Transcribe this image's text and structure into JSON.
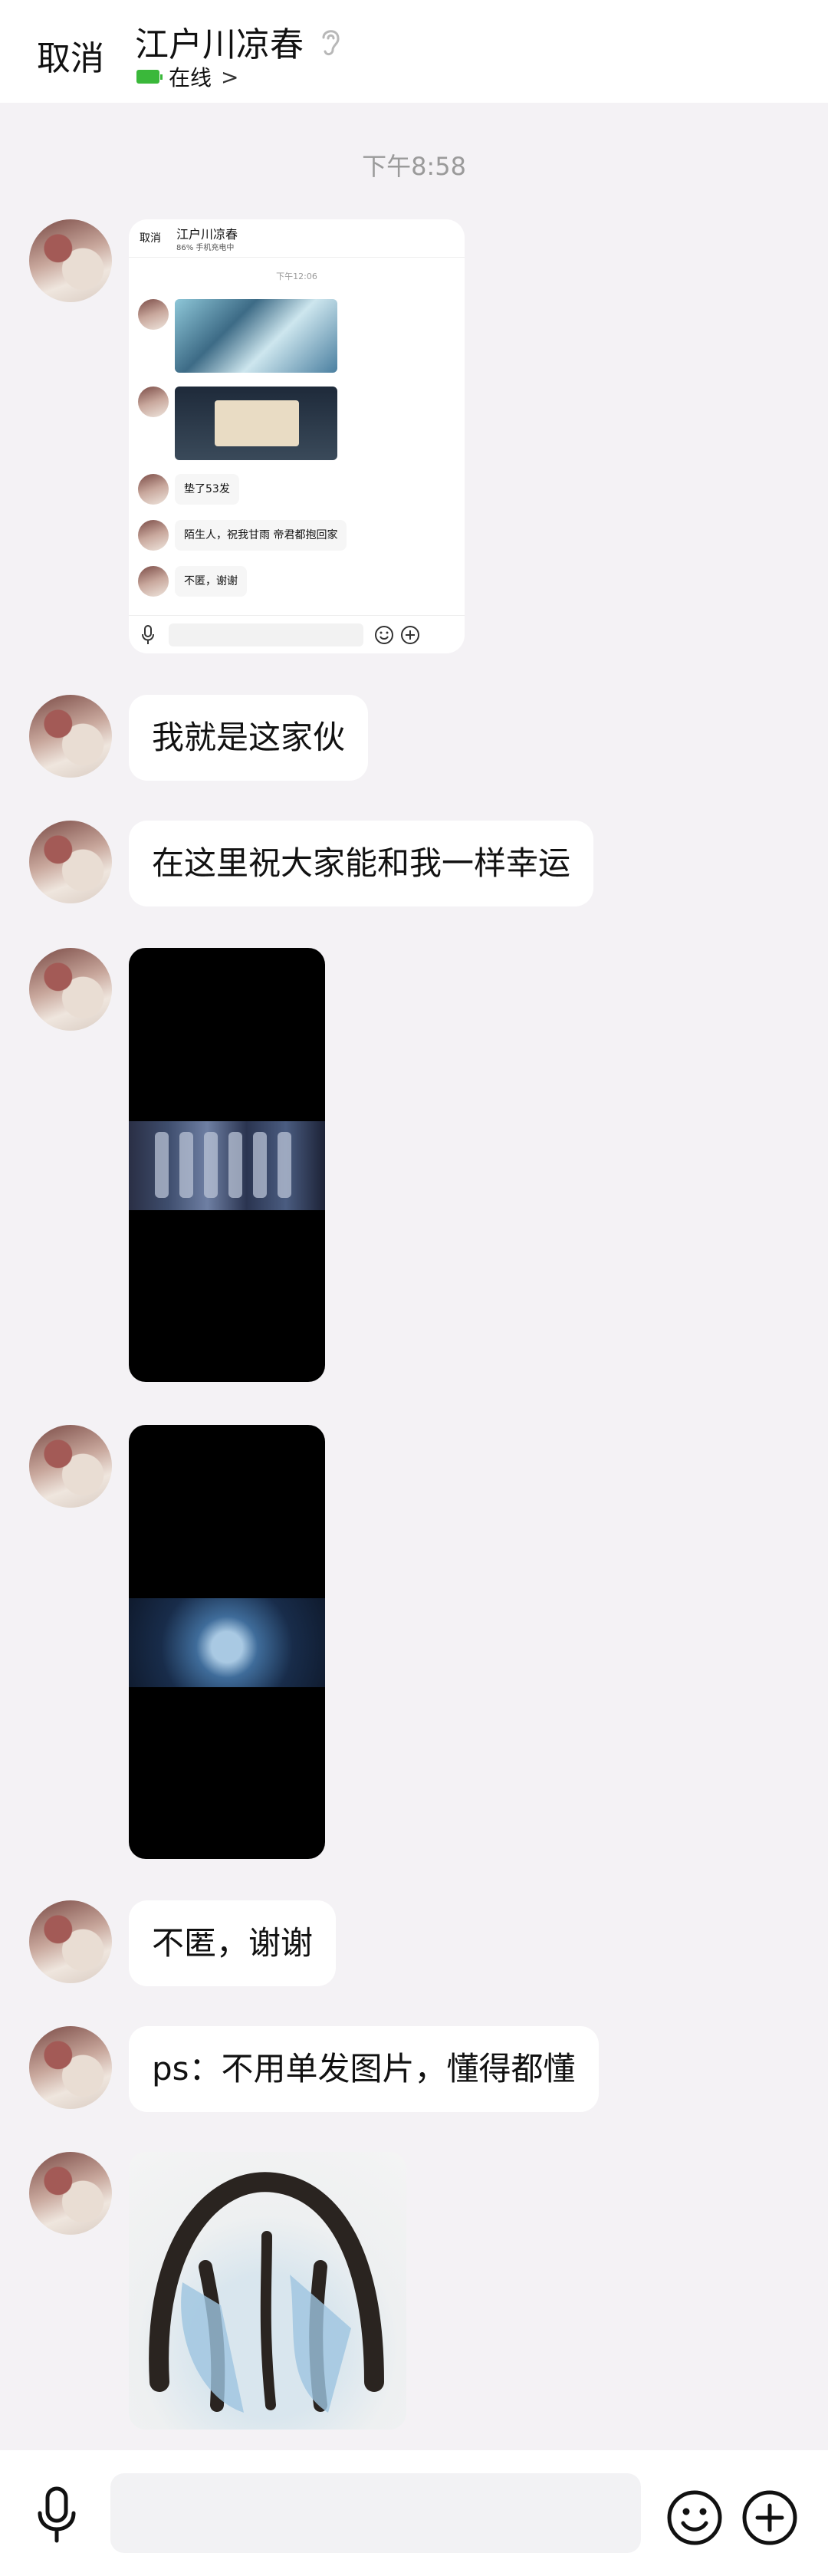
{
  "header": {
    "cancel_label": "取消",
    "contact_name": "江户川凉春",
    "status_text": "在线",
    "status_chevron": ">"
  },
  "timestamp": "下午8:58",
  "messages": [
    {
      "type": "screenshot",
      "inner": {
        "cancel_label": "取消",
        "title": "江户川凉春",
        "status": "86% 手机充电中",
        "time": "下午12:06",
        "texts": [
          "垫了53发",
          "陌生人，祝我甘雨 帝君都抱回家",
          "不匿，谢谢"
        ]
      }
    },
    {
      "type": "text",
      "text": "我就是这家伙"
    },
    {
      "type": "text",
      "text": "在这里祝大家能和我一样幸运"
    },
    {
      "type": "image",
      "description": "gacha-result-image-1"
    },
    {
      "type": "image",
      "description": "gacha-result-image-2"
    },
    {
      "type": "text",
      "text": "不匿，谢谢"
    },
    {
      "type": "text",
      "text": "ps：不用单发图片，懂得都懂"
    },
    {
      "type": "sticker"
    }
  ],
  "input_bar": {
    "icons": [
      "microphone-icon",
      "emoji-icon",
      "plus-icon"
    ]
  },
  "colors": {
    "background": "#f4f2f5",
    "bubble": "#ffffff",
    "status_green": "#3ab83a",
    "timestamp_gray": "#9a9a9a"
  }
}
